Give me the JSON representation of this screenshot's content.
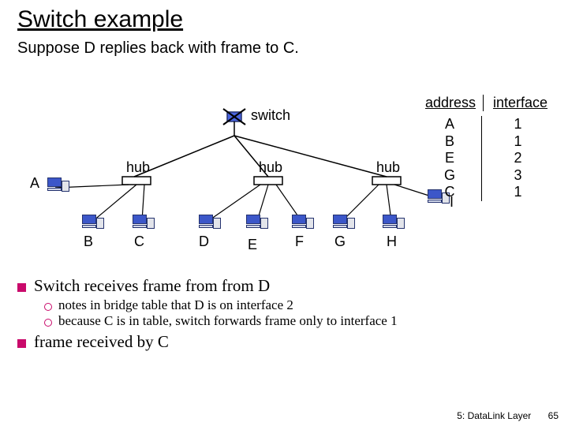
{
  "title": "Switch example",
  "subtitle": "Suppose D replies back with frame to C.",
  "labels": {
    "switch": "switch",
    "hub": "hub",
    "A": "A",
    "B": "B",
    "C": "C",
    "D": "D",
    "E": "E",
    "F": "F",
    "G": "G",
    "H": "H",
    "I": "I"
  },
  "table": {
    "addr_header": "address",
    "intf_header": "interface",
    "addr_rows": [
      "A",
      "B",
      "E",
      "G",
      "C"
    ],
    "intf_rows": [
      "1",
      "1",
      "2",
      "3",
      "1"
    ]
  },
  "bullets": {
    "main1": "Switch receives frame from from D",
    "sub1": "notes in bridge table that D is on interface 2",
    "sub2": "because C is in table, switch forwards frame only to interface 1",
    "main2": "frame received by C"
  },
  "footer": {
    "chapter": "5: DataLink Layer",
    "page": "65"
  }
}
